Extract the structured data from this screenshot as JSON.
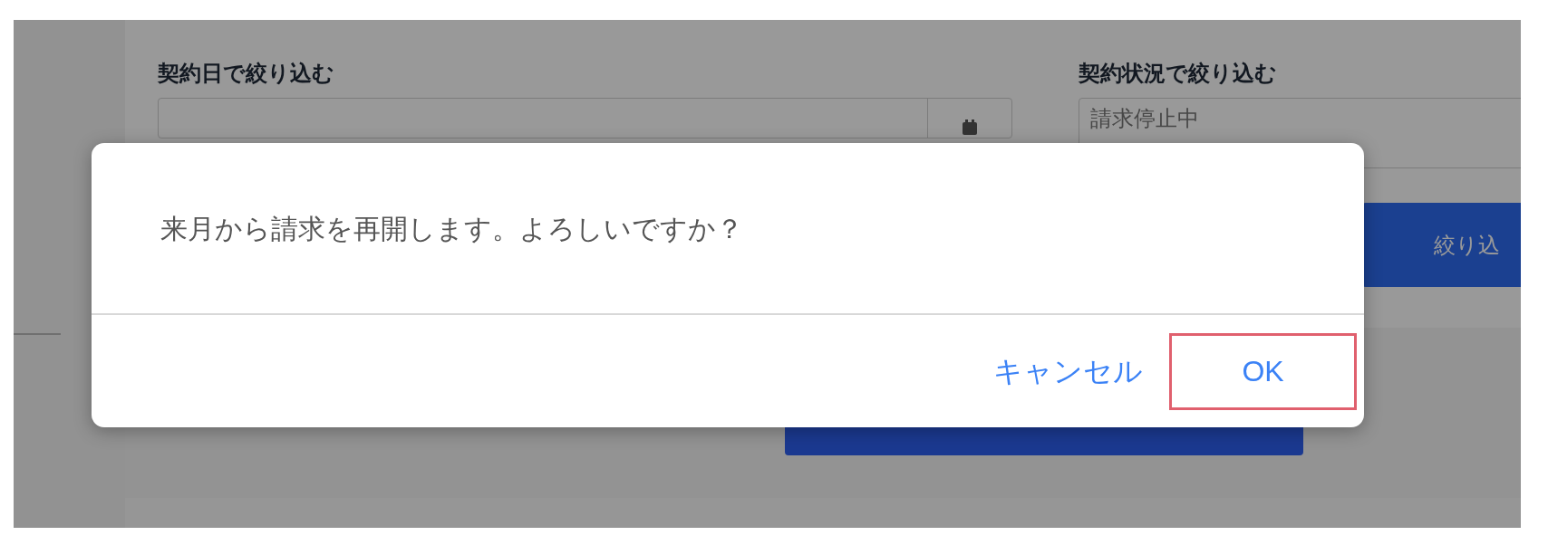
{
  "filters": [
    {
      "kind": "date",
      "label": "契約日で絞り込む"
    },
    {
      "kind": "select",
      "label": "契約状況で絞り込む",
      "value": "請求停止中"
    }
  ],
  "filter_button": {
    "label": "絞り込"
  },
  "dialog": {
    "message": "来月から請求を再開します。よろしいですか？",
    "buttons": [
      {
        "label": "キャンセル",
        "highlighted": false
      },
      {
        "label": "OK",
        "highlighted": true
      }
    ]
  }
}
